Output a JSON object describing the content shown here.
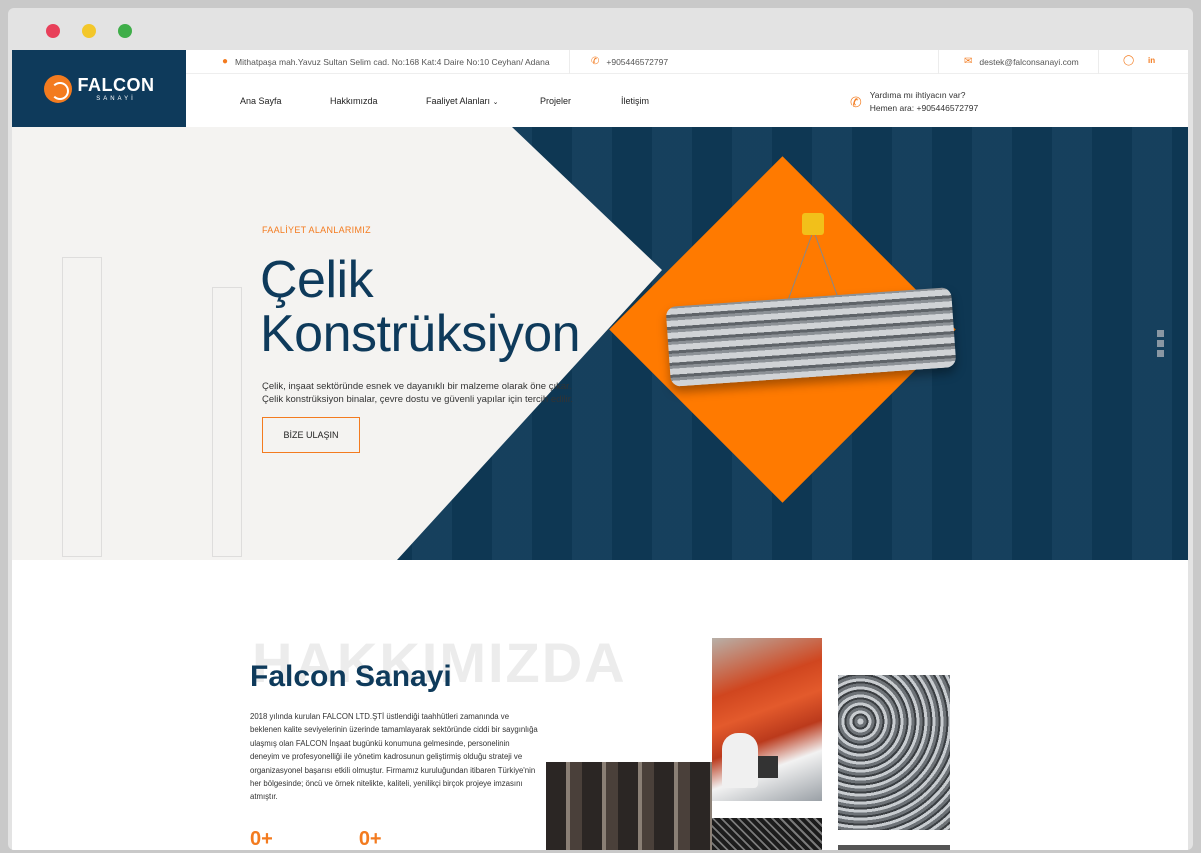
{
  "header": {
    "logo_title": "FALCON",
    "logo_sub": "SANAYİ",
    "address": "Mithatpaşa mah.Yavuz Sultan Selim cad. No:168 Kat:4 Daire No:10 Ceyhan/ Adana",
    "phone": "+905446572797",
    "email": "destek@falconsanayi.com",
    "nav": [
      "Ana Sayfa",
      "Hakkımızda",
      "Faaliyet Alanları",
      "Projeler",
      "İletişim"
    ],
    "help_line1": "Yardıma mı ihtiyacın var?",
    "help_line2": "Hemen ara: +905446572797"
  },
  "hero": {
    "eyebrow": "FAALİYET ALANLARIMIZ",
    "title": "Çelik Konstrüksiyon",
    "description_line1": "Çelik, inşaat sektöründe esnek ve dayanıklı bir malzeme olarak öne çıkar.",
    "description_line2": "Çelik konstrüksiyon binalar, çevre dostu ve güvenli yapılar için tercih edilir.",
    "button": "BİZE ULAŞIN"
  },
  "about": {
    "watermark": "HAKKIMIZDA",
    "title": "Falcon Sanayi",
    "text": "2018 yılında kurulan FALCON LTD.ŞTİ üstlendiği taahhütleri zamanında ve beklenen kalite seviyelerinin üzerinde tamamlayarak sektöründe ciddi bir saygınlığa ulaşmış olan FALCON İnşaat bugünkü konumuna gelmesinde, personelinin deneyim ve profesyonelliği ile yönetim kadrosunun geliştirmiş olduğu strateji ve organizasyonel başarısı etkili olmuştur. Firmamız kuruluğundan itibaren Türkiye'nin her bölgesinde; öncü ve örnek nitelikte, kaliteli, yenilikçi birçok projeye imzasını atmıştır.",
    "counter1": "0+",
    "counter2": "0+"
  },
  "icons": {
    "address": "map-pin-icon",
    "phone": "phone-icon",
    "email": "mail-icon",
    "social": [
      "instagram-icon",
      "linkedin-icon"
    ]
  },
  "colors": {
    "brand_navy": "#0e3a5b",
    "accent_orange": "#f37b1f"
  }
}
